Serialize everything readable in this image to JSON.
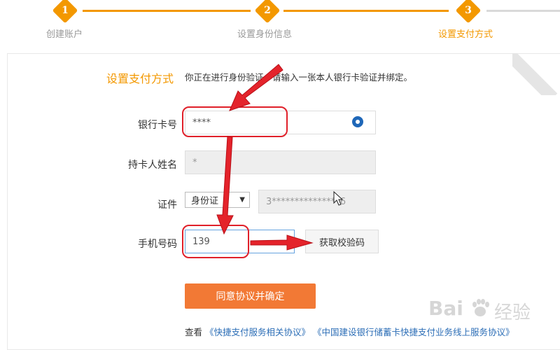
{
  "steps": [
    {
      "number": "1",
      "label": "创建账户",
      "active": false
    },
    {
      "number": "2",
      "label": "设置身份信息",
      "active": false
    },
    {
      "number": "3",
      "label": "设置支付方式",
      "active": true
    }
  ],
  "form": {
    "title": "设置支付方式",
    "instruction": "你正在进行身份验证，请输入一张本人银行卡验证并绑定。",
    "bank_card_label": "银行卡号",
    "bank_card_value": "****",
    "cardholder_label": "持卡人姓名",
    "cardholder_value": "*",
    "id_label": "证件",
    "id_type": "身份证",
    "id_number": "3***************6",
    "phone_label": "手机号码",
    "phone_value": "139",
    "get_code_label": "获取校验码",
    "confirm_label": "同意协议并确定"
  },
  "agreements": {
    "prefix": "查看",
    "link1": "《快捷支付服务相关协议》",
    "link2": "《中国建设银行储蓄卡快捷支付业务线上服务协议》"
  },
  "watermark": {
    "brand": "Bai",
    "suffix": "经验"
  },
  "colors": {
    "accent": "#f39800",
    "button": "#f27935",
    "link": "#2b6db6",
    "annotation": "#e0202a"
  }
}
